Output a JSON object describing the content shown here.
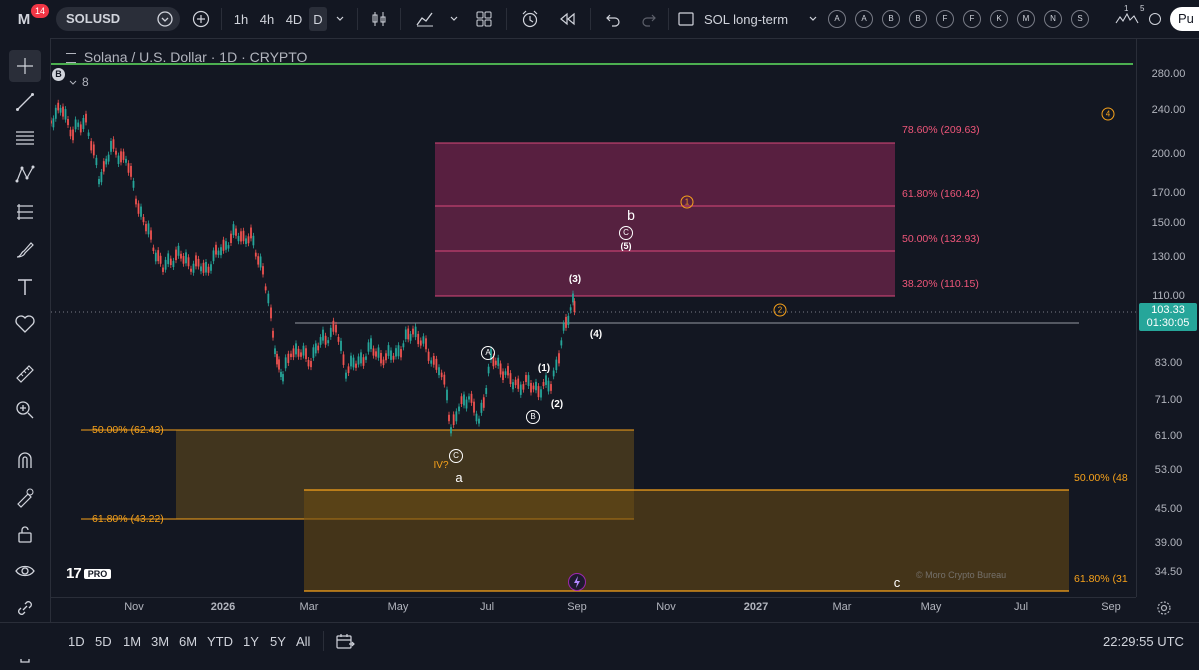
{
  "header": {
    "logo": "M",
    "notification_count": "14",
    "symbol": "SOLUSD",
    "intervals": [
      "1h",
      "4h",
      "4D",
      "D"
    ],
    "layout_name": "SOL long-term",
    "alert_letters": [
      "A",
      "A",
      "B",
      "B",
      "F",
      "F",
      "K",
      "M",
      "N",
      "S"
    ],
    "extra_counts": [
      "1",
      "5"
    ],
    "publish_label": "Pu"
  },
  "legend": {
    "title": "Solana / U.S. Dollar · 1D · CRYPTO",
    "indicator_badge": "B",
    "indicator_value": "8"
  },
  "price_axis": {
    "labels": [
      "280.00",
      "240.00",
      "200.00",
      "170.00",
      "150.00",
      "130.00",
      "110.00",
      "83.00",
      "71.00",
      "61.00",
      "53.00",
      "45.00",
      "39.00",
      "34.50"
    ],
    "current_price": "103.33",
    "countdown": "01:30:05",
    "current_price_color": "#26a69a"
  },
  "time_axis": {
    "labels": [
      "Nov",
      "2026",
      "Mar",
      "May",
      "Jul",
      "Sep",
      "Nov",
      "2027",
      "Mar",
      "May",
      "Jul",
      "Sep"
    ]
  },
  "fib_upper": [
    {
      "label": "78.60% (209.63)",
      "color": "#f0567a"
    },
    {
      "label": "61.80% (160.42)",
      "color": "#f0567a"
    },
    {
      "label": "50.00% (132.93)",
      "color": "#f0567a"
    },
    {
      "label": "38.20% (110.15)",
      "color": "#f0567a"
    }
  ],
  "fib_lower_left": [
    {
      "label": "50.00% (62.43)",
      "color": "#f7a21b"
    },
    {
      "label": "61.80% (43.22)",
      "color": "#f7a21b"
    }
  ],
  "fib_lower_right": [
    {
      "label": "50.00% (48",
      "color": "#f7a21b"
    },
    {
      "label": "61.80% (31",
      "color": "#f7a21b"
    }
  ],
  "wave_labels": {
    "w3": "(3)",
    "w4": "(4)",
    "w1": "(1)",
    "w2": "(2)",
    "w5": "(5)",
    "b": "b",
    "a": "a",
    "c": "c",
    "iv": "IV?"
  },
  "circled_labels": {
    "A": "A",
    "B": "B",
    "C_low": "C",
    "C_high": "C",
    "orange_1": "1",
    "orange_2": "2",
    "orange_4": "4"
  },
  "watermark": "© Moro Crypto Bureau",
  "brand_pro": "PRO",
  "bottom": {
    "ranges": [
      "1D",
      "5D",
      "1M",
      "3M",
      "6M",
      "YTD",
      "1Y",
      "5Y",
      "All"
    ],
    "time": "22:29:55 UTC"
  }
}
